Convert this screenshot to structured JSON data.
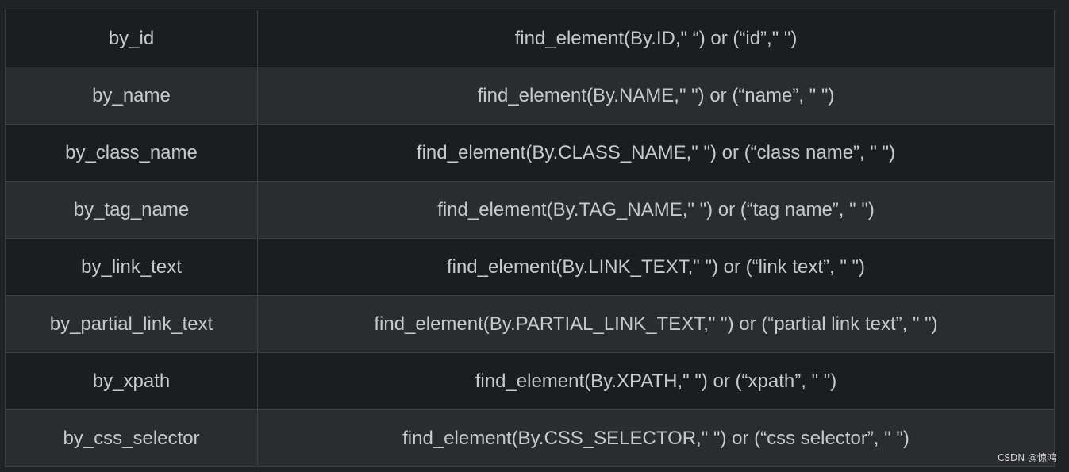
{
  "table": {
    "rows": [
      {
        "method": "by_id",
        "usage": "find_element(By.ID,\" “) or (“id”,\" \")"
      },
      {
        "method": "by_name",
        "usage": "find_element(By.NAME,\" \") or (“name”, \" \")"
      },
      {
        "method": "by_class_name",
        "usage": "find_element(By.CLASS_NAME,\" \") or (“class name”, \" \")"
      },
      {
        "method": "by_tag_name",
        "usage": "find_element(By.TAG_NAME,\" \") or (“tag name”, \" \")"
      },
      {
        "method": "by_link_text",
        "usage": "find_element(By.LINK_TEXT,\" \") or (“link text”, \" \")"
      },
      {
        "method": "by_partial_link_text",
        "usage": "find_element(By.PARTIAL_LINK_TEXT,\" \") or (“partial link text”, \" \")"
      },
      {
        "method": "by_xpath",
        "usage": "find_element(By.XPATH,\" \") or (“xpath”, \" \")"
      },
      {
        "method": "by_css_selector",
        "usage": "find_element(By.CSS_SELECTOR,\" \") or (“css selector”, \" \")"
      }
    ]
  },
  "watermark": "CSDN @惊鸿"
}
